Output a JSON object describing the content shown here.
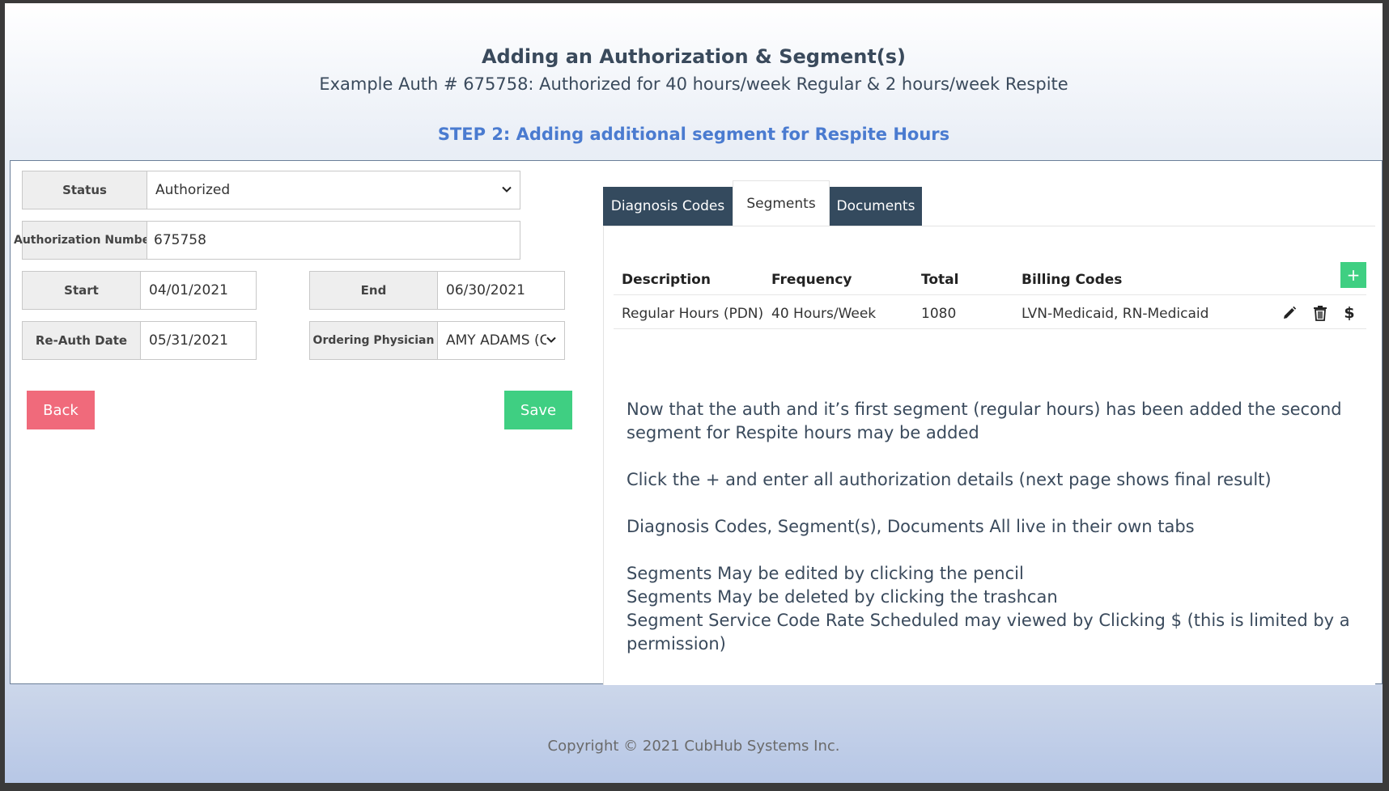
{
  "slide": {
    "title": "Adding an Authorization & Segment(s)",
    "subtitle": "Example Auth # 675758: Authorized for 40 hours/week Regular & 2 hours/week Respite",
    "step": "STEP 2: Adding additional segment for Respite Hours",
    "copyright": "Copyright © 2021 CubHub Systems Inc."
  },
  "form": {
    "status_label": "Status",
    "status_value": "Authorized",
    "auth_number_label": "Authorization Number",
    "auth_number_value": "675758",
    "start_label": "Start",
    "start_value": "04/01/2021",
    "end_label": "End",
    "end_value": "06/30/2021",
    "reauth_label": "Re-Auth Date",
    "reauth_value": "05/31/2021",
    "physician_label": "Ordering Physician",
    "physician_value": "AMY ADAMS (C",
    "back_label": "Back",
    "save_label": "Save"
  },
  "tabs": {
    "diagnosis": "Diagnosis Codes",
    "segments": "Segments",
    "documents": "Documents"
  },
  "segments_table": {
    "headers": [
      "Description",
      "Frequency",
      "Total",
      "Billing Codes"
    ],
    "add_label": "+",
    "rows": [
      {
        "description": "Regular Hours (PDN)",
        "frequency": "40 Hours/Week",
        "total": "1080",
        "billing_codes": "LVN-Medicaid, RN-Medicaid",
        "rate_label": "$"
      }
    ]
  },
  "notes": [
    "Now that the auth and it’s first segment (regular hours) has been added the second segment for Respite hours may be added",
    "Click the + and enter all authorization details (next page shows final result)",
    "Diagnosis Codes, Segment(s), Documents All live in their own tabs",
    "Segments May be edited by clicking the pencil",
    "Segments May be deleted by clicking the trashcan",
    "Segment Service Code Rate Scheduled may viewed by Clicking $ (this is limited by a permission)"
  ],
  "icons": {
    "edit": "pencil-icon",
    "delete": "trash-icon",
    "rate": "dollar-icon",
    "dropdown": "chevron-down-icon"
  },
  "colors": {
    "back_button": "#f06a7b",
    "save_button": "#3fcf82",
    "tab_dark": "#344a5e",
    "step_text": "#4a7bd0"
  }
}
